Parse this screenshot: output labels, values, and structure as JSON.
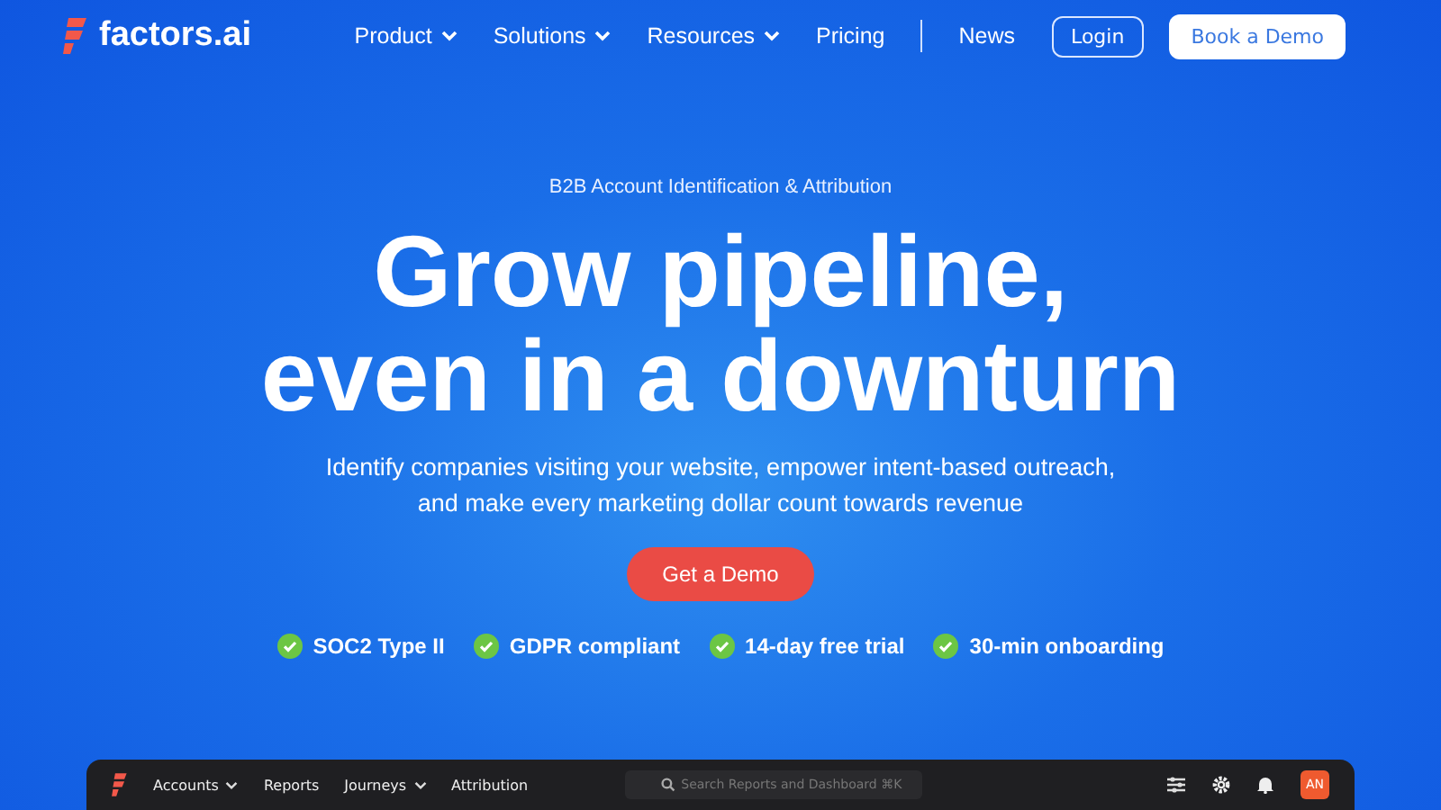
{
  "header": {
    "logo": "factors.ai",
    "nav": [
      {
        "label": "Product",
        "dropdown": true
      },
      {
        "label": "Solutions",
        "dropdown": true
      },
      {
        "label": "Resources",
        "dropdown": true
      },
      {
        "label": "Pricing",
        "dropdown": false
      }
    ],
    "news": "News",
    "login": "Login",
    "cta": "Book a Demo"
  },
  "hero": {
    "eyebrow": "B2B Account Identification & Attribution",
    "headline": [
      "Grow pipeline,",
      "even in a downturn"
    ],
    "subtitle": "Identify companies visiting your website, empower intent-based outreach, and make every marketing dollar count towards revenue",
    "button": "Get a Demo",
    "badges": [
      "SOC2 Type II",
      "GDPR compliant",
      "14-day free trial",
      "30-min onboarding"
    ]
  },
  "app_preview": {
    "menu": [
      {
        "label": "Accounts",
        "dropdown": true
      },
      {
        "label": "Reports",
        "dropdown": false
      },
      {
        "label": "Journeys",
        "dropdown": true
      },
      {
        "label": "Attribution",
        "dropdown": false
      }
    ],
    "search": {
      "placeholder": "Search Reports and Dashboard ⌘K"
    },
    "avatar": "AN"
  }
}
